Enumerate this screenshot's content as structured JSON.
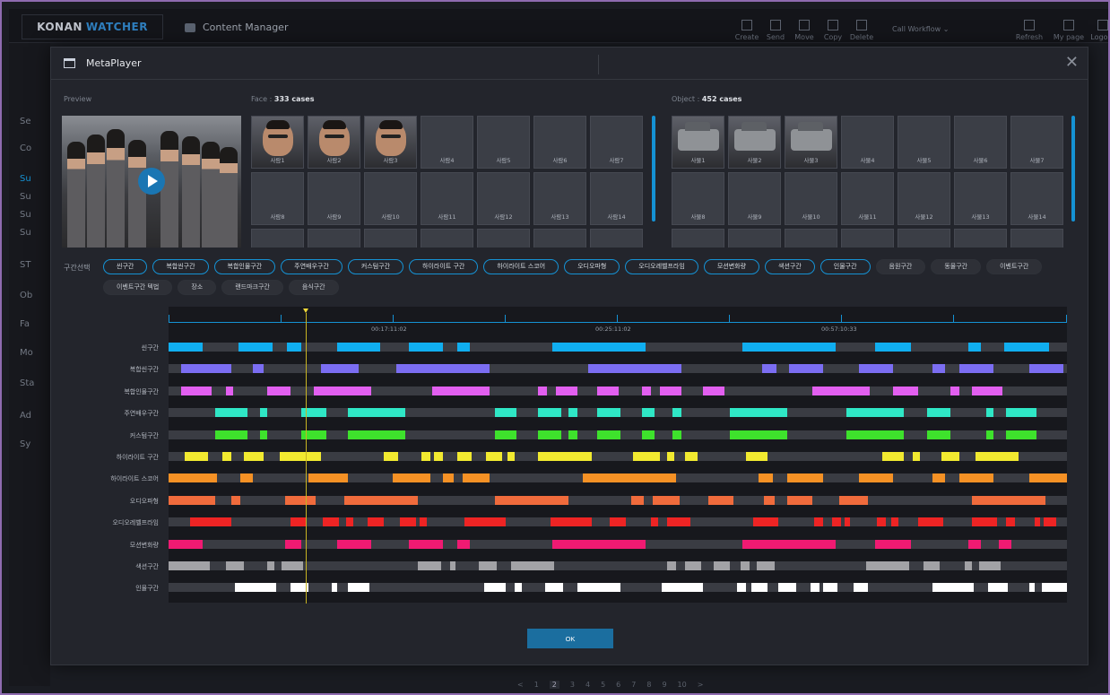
{
  "app": {
    "brand": "KONAN",
    "brand_accent": "WATCHER",
    "title": "Content Manager",
    "toolbar": [
      "Create",
      "Send",
      "Move",
      "Copy",
      "Delete"
    ],
    "workflow": "Call Workflow",
    "right_tools": [
      "Refresh",
      "My page",
      "Logout"
    ],
    "sidebar": [
      "Se",
      "Co",
      "Su",
      "Su",
      "Su",
      "Su",
      "ST",
      "Ob",
      "Fa",
      "Mo",
      "Sta",
      "Ad",
      "Sy"
    ],
    "pager": [
      "<",
      "1",
      "2",
      "3",
      "4",
      "5",
      "6",
      "7",
      "8",
      "9",
      "10",
      ">"
    ],
    "pager_current": "2"
  },
  "modal": {
    "title": "MetaPlayer",
    "preview_label": "Preview",
    "face_label": "Face : ",
    "face_count": "333 cases",
    "object_label": "Object : ",
    "object_count": "452 cases",
    "faces": [
      "사람1",
      "사람2",
      "사람3",
      "사람4",
      "사람5",
      "사람6",
      "사람7",
      "사람8",
      "사람9",
      "사람10",
      "사람11",
      "사람12",
      "사람13",
      "사람14"
    ],
    "objects": [
      "사물1",
      "사물2",
      "사물3",
      "사물4",
      "사물5",
      "사물6",
      "사물7",
      "사물8",
      "사물9",
      "사물10",
      "사물11",
      "사물12",
      "사물13",
      "사물14"
    ],
    "section_label": "구간선택",
    "chips_active": [
      "씬구간",
      "복합씬구간",
      "복합인물구간",
      "주연배우구간",
      "커스텀구간",
      "하이라이트 구간",
      "하이라이트 스코어",
      "오디오파형",
      "오디오레벨프라임",
      "모션변화량",
      "색션구간",
      "인물구간"
    ],
    "chips_inactive": [
      "음원구간",
      "동물구간",
      "이벤트구간",
      "이벤트구간 텍법",
      "장소",
      "랜드마크구간",
      "음식구간"
    ],
    "timeline": {
      "labels": [
        "00:17:11:02",
        "00:25:11:02",
        "00:57:10:33"
      ],
      "rows": [
        {
          "name": "씬구간",
          "color": "#10aef0",
          "segs": [
            [
              0,
              38
            ],
            [
              78,
              116
            ],
            [
              132,
              148
            ],
            [
              188,
              236
            ],
            [
              268,
              306
            ],
            [
              322,
              336
            ],
            [
              428,
              532
            ],
            [
              640,
              744
            ],
            [
              788,
              828
            ],
            [
              892,
              906
            ],
            [
              932,
              982
            ]
          ]
        },
        {
          "name": "복합씬구간",
          "color": "#7b6df2",
          "segs": [
            [
              14,
              70
            ],
            [
              94,
              106
            ],
            [
              170,
              212
            ],
            [
              254,
              358
            ],
            [
              468,
              572
            ],
            [
              662,
              678
            ],
            [
              692,
              730
            ],
            [
              770,
              808
            ],
            [
              852,
              866
            ],
            [
              882,
              920
            ],
            [
              960,
              998
            ]
          ]
        },
        {
          "name": "복합인물구간",
          "color": "#e25ff0",
          "segs": [
            [
              14,
              48
            ],
            [
              64,
              72
            ],
            [
              110,
              136
            ],
            [
              162,
              226
            ],
            [
              294,
              358
            ],
            [
              412,
              422
            ],
            [
              432,
              456
            ],
            [
              478,
              502
            ],
            [
              528,
              538
            ],
            [
              548,
              572
            ],
            [
              596,
              620
            ],
            [
              718,
              782
            ],
            [
              808,
              836
            ],
            [
              872,
              882
            ],
            [
              896,
              930
            ]
          ]
        },
        {
          "name": "주연배우구간",
          "color": "#2fe7c6",
          "segs": [
            [
              52,
              88
            ],
            [
              102,
              110
            ],
            [
              148,
              176
            ],
            [
              200,
              264
            ],
            [
              364,
              388
            ],
            [
              412,
              438
            ],
            [
              446,
              456
            ],
            [
              478,
              504
            ],
            [
              528,
              542
            ],
            [
              562,
              572
            ],
            [
              626,
              690
            ],
            [
              756,
              820
            ],
            [
              846,
              872
            ],
            [
              912,
              920
            ],
            [
              934,
              968
            ]
          ]
        },
        {
          "name": "커스텀구간",
          "color": "#3ee22c",
          "segs": [
            [
              52,
              88
            ],
            [
              102,
              110
            ],
            [
              148,
              176
            ],
            [
              200,
              264
            ],
            [
              364,
              388
            ],
            [
              412,
              438
            ],
            [
              446,
              456
            ],
            [
              478,
              504
            ],
            [
              528,
              542
            ],
            [
              562,
              572
            ],
            [
              626,
              690
            ],
            [
              756,
              820
            ],
            [
              846,
              872
            ],
            [
              912,
              920
            ],
            [
              934,
              968
            ]
          ]
        },
        {
          "name": "하이라이트 구간",
          "color": "#f2ea30",
          "segs": [
            [
              18,
              44
            ],
            [
              60,
              70
            ],
            [
              84,
              106
            ],
            [
              124,
              170
            ],
            [
              240,
              256
            ],
            [
              282,
              292
            ],
            [
              296,
              306
            ],
            [
              322,
              338
            ],
            [
              354,
              372
            ],
            [
              378,
              386
            ],
            [
              412,
              472
            ],
            [
              518,
              548
            ],
            [
              556,
              564
            ],
            [
              576,
              590
            ],
            [
              644,
              668
            ],
            [
              796,
              820
            ],
            [
              830,
              838
            ],
            [
              862,
              882
            ],
            [
              900,
              948
            ]
          ]
        },
        {
          "name": "하이라이트 스코어",
          "color": "#f59125",
          "segs": [
            [
              0,
              54
            ],
            [
              80,
              94
            ],
            [
              156,
              200
            ],
            [
              250,
              292
            ],
            [
              306,
              318
            ],
            [
              328,
              358
            ],
            [
              462,
              566
            ],
            [
              658,
              674
            ],
            [
              690,
              730
            ],
            [
              770,
              808
            ],
            [
              852,
              866
            ],
            [
              882,
              920
            ],
            [
              960,
              1002
            ]
          ]
        },
        {
          "name": "오디오파형",
          "color": "#f06b3c",
          "segs": [
            [
              0,
              52
            ],
            [
              70,
              80
            ],
            [
              130,
              164
            ],
            [
              196,
              278
            ],
            [
              364,
              446
            ],
            [
              516,
              530
            ],
            [
              540,
              570
            ],
            [
              602,
              630
            ],
            [
              664,
              676
            ],
            [
              690,
              718
            ],
            [
              748,
              780
            ],
            [
              896,
              978
            ]
          ]
        },
        {
          "name": "오디오레벨프라임",
          "color": "#ee2424",
          "segs": [
            [
              24,
              70
            ],
            [
              136,
              154
            ],
            [
              172,
              190
            ],
            [
              198,
              206
            ],
            [
              222,
              240
            ],
            [
              258,
              276
            ],
            [
              280,
              288
            ],
            [
              330,
              376
            ],
            [
              426,
              472
            ],
            [
              492,
              510
            ],
            [
              538,
              546
            ],
            [
              556,
              582
            ],
            [
              652,
              680
            ],
            [
              720,
              730
            ],
            [
              740,
              750
            ],
            [
              754,
              760
            ],
            [
              790,
              800
            ],
            [
              806,
              814
            ],
            [
              836,
              864
            ],
            [
              896,
              924
            ],
            [
              934,
              944
            ],
            [
              966,
              972
            ],
            [
              976,
              990
            ]
          ]
        },
        {
          "name": "모션변화량",
          "color": "#f01a72",
          "segs": [
            [
              0,
              38
            ],
            [
              130,
              148
            ],
            [
              188,
              226
            ],
            [
              268,
              306
            ],
            [
              322,
              336
            ],
            [
              428,
              532
            ],
            [
              640,
              744
            ],
            [
              788,
              828
            ],
            [
              892,
              906
            ],
            [
              926,
              940
            ]
          ]
        },
        {
          "name": "색션구간",
          "color": "#a2a2a6",
          "segs": [
            [
              0,
              46
            ],
            [
              64,
              84
            ],
            [
              110,
              118
            ],
            [
              126,
              150
            ],
            [
              278,
              304
            ],
            [
              314,
              320
            ],
            [
              346,
              366
            ],
            [
              382,
              430
            ],
            [
              556,
              566
            ],
            [
              576,
              594
            ],
            [
              608,
              626
            ],
            [
              638,
              648
            ],
            [
              656,
              676
            ],
            [
              778,
              826
            ],
            [
              842,
              860
            ],
            [
              888,
              896
            ],
            [
              904,
              928
            ]
          ]
        },
        {
          "name": "인물구간",
          "color": "#ffffff",
          "segs": [
            [
              74,
              120
            ],
            [
              136,
              156
            ],
            [
              182,
              188
            ],
            [
              200,
              224
            ],
            [
              352,
              376
            ],
            [
              386,
              394
            ],
            [
              420,
              440
            ],
            [
              456,
              504
            ],
            [
              550,
              596
            ],
            [
              634,
              644
            ],
            [
              650,
              668
            ],
            [
              680,
              700
            ],
            [
              716,
              726
            ],
            [
              730,
              746
            ],
            [
              764,
              780
            ],
            [
              852,
              898
            ],
            [
              914,
              936
            ],
            [
              960,
              966
            ],
            [
              974,
              1002
            ]
          ]
        }
      ]
    },
    "ok": "OK"
  }
}
